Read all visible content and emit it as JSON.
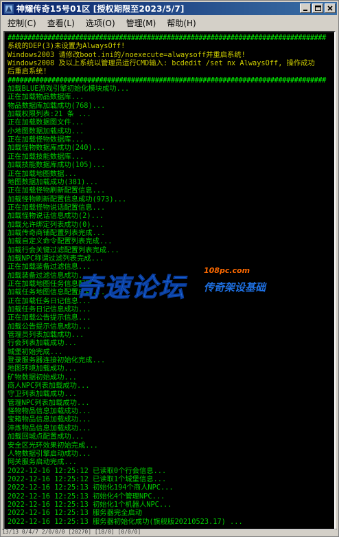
{
  "window": {
    "title": "神耀传奇15号01区 [授权期限至2023/5/7]"
  },
  "menu": [
    "控制(C)",
    "查看(L)",
    "选项(O)",
    "管理(M)",
    "帮助(H)"
  ],
  "console_lines": [
    {
      "text": "################################################################################",
      "kind": "sep"
    },
    {
      "text": "系统的DEP(3)未设置为AlwaysOff!",
      "kind": "warn"
    },
    {
      "text": "Windows2003 请修改boot.ini的/noexecute=alwaysoff并重启系统!",
      "kind": "warn"
    },
    {
      "text": "Windows2008 及以上系统以管理员运行CMD输入: bcdedit /set nx AlwaysOff, 操作成功",
      "kind": "warn"
    },
    {
      "text": "后重启系统!",
      "kind": "warn"
    },
    {
      "text": "################################################################################",
      "kind": "sep"
    },
    {
      "text": "加载BLUE游戏引擎初始化模块成功...",
      "kind": "log"
    },
    {
      "text": "正在加载物品数据库...",
      "kind": "log"
    },
    {
      "text": "物品数据库加载成功(768)...",
      "kind": "log"
    },
    {
      "text": "加载权限列表:21 条 ...",
      "kind": "log"
    },
    {
      "text": "正在加载数据图文件...",
      "kind": "log"
    },
    {
      "text": "小地图数据加载成功...",
      "kind": "log"
    },
    {
      "text": "正在加载怪物数据库...",
      "kind": "log"
    },
    {
      "text": "加载怪物数据库成功(240)...",
      "kind": "log"
    },
    {
      "text": "正在加载技能数据库...",
      "kind": "log"
    },
    {
      "text": "加载技能数据库成功(105)...",
      "kind": "log"
    },
    {
      "text": "正在加载地图数据...",
      "kind": "log"
    },
    {
      "text": "地图数据加载成功(381)...",
      "kind": "log"
    },
    {
      "text": "正在加载怪物刷新配置信息...",
      "kind": "log"
    },
    {
      "text": "加载怪物刷新配置信息成功(973)...",
      "kind": "log"
    },
    {
      "text": "正在加载怪物说话配置信息...",
      "kind": "log"
    },
    {
      "text": "加载怪物说话信息成功(2)...",
      "kind": "log"
    },
    {
      "text": "加载允许绑定列表成功(0)...",
      "kind": "log"
    },
    {
      "text": "加载传奇商铺配置列表完成...",
      "kind": "log"
    },
    {
      "text": "加载自定义命令配置列表完成...",
      "kind": "log"
    },
    {
      "text": "加载行会关键过滤配置列表完成...",
      "kind": "log"
    },
    {
      "text": "加载NPC称谓过滤列表完成...",
      "kind": "log"
    },
    {
      "text": "正在加载装备过滤信息...",
      "kind": "log"
    },
    {
      "text": "加载装备过滤信息成功...",
      "kind": "log"
    },
    {
      "text": "正在加载地图任务信息配置...",
      "kind": "log"
    },
    {
      "text": "加载任务地图信息配置成功...",
      "kind": "log"
    },
    {
      "text": "正在加载任务日记信息...",
      "kind": "log"
    },
    {
      "text": "加载任务日记信息成功...",
      "kind": "log"
    },
    {
      "text": "正在加载公告提示信息...",
      "kind": "log"
    },
    {
      "text": "加载公告提示信息成功...",
      "kind": "log"
    },
    {
      "text": "管理员列表加载成功...",
      "kind": "log"
    },
    {
      "text": "行会列表加载成功...",
      "kind": "log"
    },
    {
      "text": "城堡初始完成...",
      "kind": "log"
    },
    {
      "text": "登录服务器连接初始化完成...",
      "kind": "log"
    },
    {
      "text": "地图环境加载成功...",
      "kind": "log"
    },
    {
      "text": "矿物数据初始成功...",
      "kind": "log"
    },
    {
      "text": "商人NPC列表加载成功...",
      "kind": "log"
    },
    {
      "text": "守卫列表加载成功...",
      "kind": "log"
    },
    {
      "text": "管理NPC列表加载成功...",
      "kind": "log"
    },
    {
      "text": "怪物物品信息加载成功...",
      "kind": "log"
    },
    {
      "text": "宝箱物品信息加载成功...",
      "kind": "log"
    },
    {
      "text": "淬炼物品信息加载成功...",
      "kind": "log"
    },
    {
      "text": "加载回城点配置成功...",
      "kind": "log"
    },
    {
      "text": "安全区光环效果初始完成...",
      "kind": "log"
    },
    {
      "text": "人物数据引擎启动成功...",
      "kind": "log"
    },
    {
      "text": "网关服务启动完成...",
      "kind": "log"
    },
    {
      "text": "2022-12-16 12:25:12 已读取0个行会信息...",
      "kind": "log"
    },
    {
      "text": "2022-12-16 12:25:12 已读取1个城堡信息...",
      "kind": "log"
    },
    {
      "text": "2022-12-16 12:25:13 初始化194个商人NPC...",
      "kind": "log"
    },
    {
      "text": "2022-12-16 12:25:13 初始化4个管理NPC...",
      "kind": "log"
    },
    {
      "text": "2022-12-16 12:25:13 初始化1个机器人NPC...",
      "kind": "log"
    },
    {
      "text": "2022-12-16 12:25:13 服务器完全启动",
      "kind": "log"
    },
    {
      "text": "2022-12-16 12:25:13 服务器初始化成功(旗舰版20210523.17) ...",
      "kind": "log"
    }
  ],
  "watermark": {
    "main": "奇速论坛",
    "domain": "108pc.com",
    "sub": "传奇架设基础"
  },
  "statusbar": {
    "text": "  13/13       0/4/7    2/0/0/0                                   [20270] [18/0] [0/0/0]"
  },
  "colors": {
    "title_gradient_start": "#0a246a",
    "console_bg": "#000000",
    "log_green": "#00cc00",
    "warn_yellow": "#cccc00"
  }
}
